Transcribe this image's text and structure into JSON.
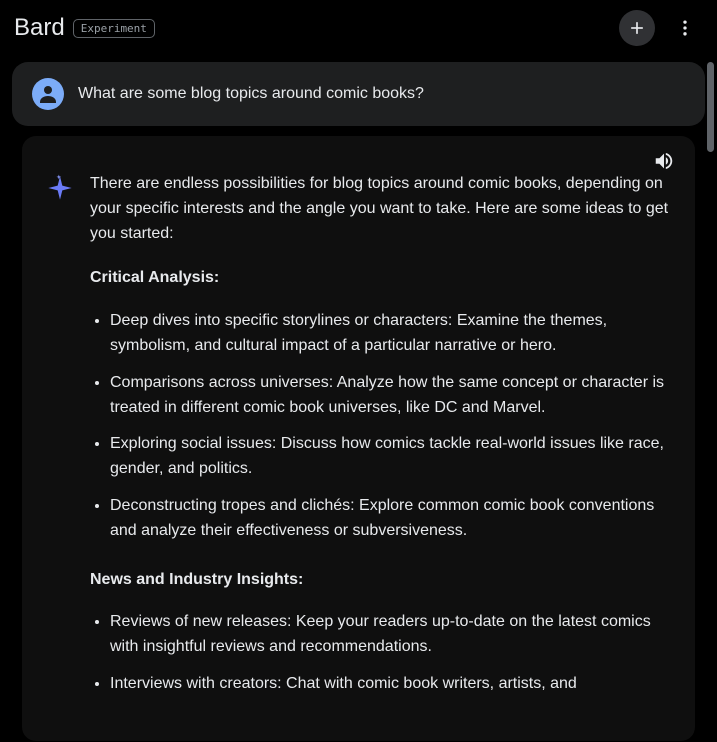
{
  "header": {
    "brand": "Bard",
    "badge": "Experiment"
  },
  "user_message": {
    "text": "What are some blog topics around comic books?"
  },
  "response": {
    "intro": "There are endless possibilities for blog topics around comic books, depending on your specific interests and the angle you want to take. Here are some ideas to get you started:",
    "sections": [
      {
        "heading": "Critical Analysis:",
        "items": [
          "Deep dives into specific storylines or characters: Examine the themes, symbolism, and cultural impact of a particular narrative or hero.",
          "Comparisons across universes: Analyze how the same concept or character is treated in different comic book universes, like DC and Marvel.",
          "Exploring social issues: Discuss how comics tackle real-world issues like race, gender, and politics.",
          "Deconstructing tropes and clichés: Explore common comic book conventions and analyze their effectiveness or subversiveness."
        ]
      },
      {
        "heading": "News and Industry Insights:",
        "items": [
          "Reviews of new releases: Keep your readers up-to-date on the latest comics with insightful reviews and recommendations.",
          "Interviews with creators: Chat with comic book writers, artists, and"
        ]
      }
    ]
  }
}
